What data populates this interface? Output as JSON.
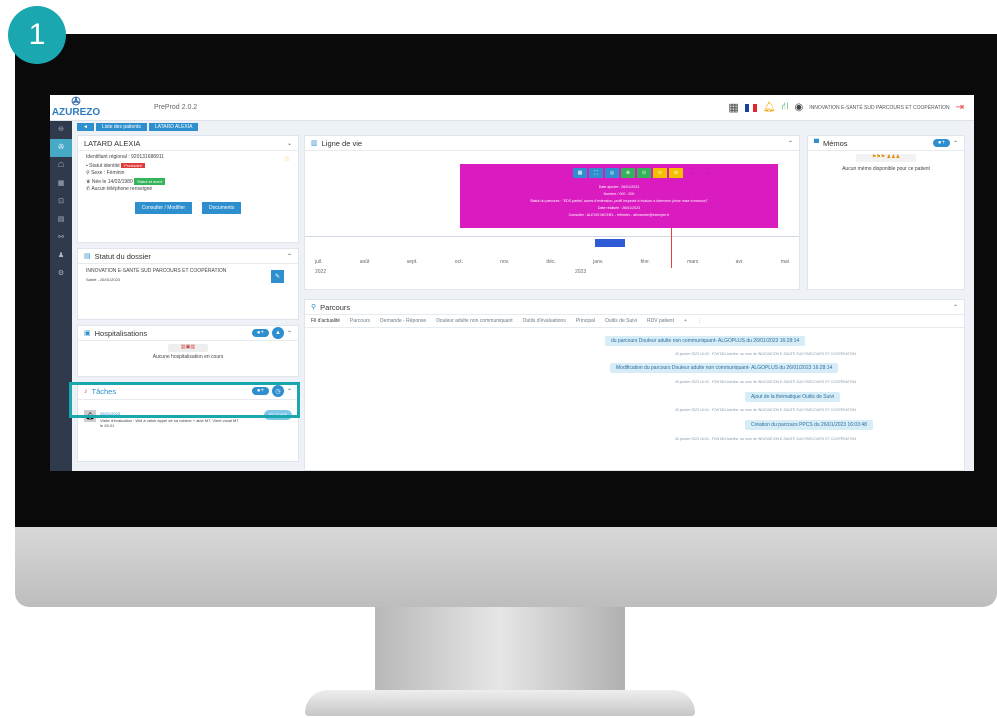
{
  "badge": {
    "number": "1"
  },
  "app": {
    "logo": "AZUREZO",
    "version": "PreProd 2.0.2",
    "org_name": "INNOVATION E-SANTÉ SUD PARCOURS ET COOPÉRATION"
  },
  "breadcrumb": [
    "Liste des patients",
    "LATARD ALEXIA"
  ],
  "patient": {
    "name": "LATARD ALEXIA",
    "id_line": "Identifiant régional : 920131688911",
    "statut_label": "Statut identité",
    "statut_value": "Provisoire",
    "sexe": "Sexe : Féminin",
    "birth": "Née le 14/02/1980",
    "birth_tag": "Statut et avert",
    "phone": "Aucun téléphone renseigné",
    "btn_consult": "Consulter / Modifier",
    "btn_docs": "Documents"
  },
  "dossier": {
    "title": "Statut du dossier",
    "org": "INNOVATION E-SANTÉ SUD PARCOURS ET COOPÉRATION",
    "line2": "Santé - 26/01/2023"
  },
  "hospitalisations": {
    "title": "Hospitalisations",
    "empty": "Aucune hospitalisation en cours"
  },
  "taches": {
    "title": "Tâches",
    "task_date": "26/01/2023",
    "task_text": "Visite d'évaluation : Wid à valoir appel de sa voisine + aide MT. Vient vocal MT le 26.01",
    "task_btn": "En cours"
  },
  "ligne_de_vie": {
    "title": "Ligne de vie",
    "months": [
      "juil.",
      "août",
      "sept.",
      "oct.",
      "nov.",
      "déc.",
      "janv.",
      "févr.",
      "mars",
      "avr.",
      "mai"
    ],
    "years": [
      "2022",
      "2023"
    ],
    "popup_lines": [
      "Date ajouter : 26/01/2023",
      "Nombre / 000 : 000",
      "Statut du parcours : \"EDS partiel, accès d'extension, profil inspecté à évaluer à intervenir (mise mise à mesure)\"",
      "Date réalisée : 26/01/2023",
      "Consulter : ALEXIS MICHEL - Infirmier - alexandre@exemple.fr"
    ]
  },
  "memos": {
    "title": "Mémos",
    "empty": "Aucun mémo disponible pour ce patient"
  },
  "parcours": {
    "title": "Parcours",
    "tabs": [
      "Fil d'actualité",
      "Parcours",
      "Demande - Réponse",
      "Douleur adulte non communiquant",
      "Outils d'évaluations",
      "Principal",
      "Outils de Suivi",
      "RDV patient"
    ],
    "events": [
      {
        "text": "du parcours Douleur adulte non communiquant- ALGOPLUS du 26/01/2023 16:28:14",
        "meta": "26 janvier 2023 16:30 - FONTAN Adeline, au nom de INNOVATION E-SANTÉ SUD PARCOURS ET COOPÉRATION"
      },
      {
        "text": "Modification du parcours Douleur adulte non communiquant- ALGOPLUS du 26/01/2023 16:28:14",
        "meta": "26 janvier 2023 16:30 - FONTAN Adeline, au nom de INNOVATION E-SANTÉ SUD PARCOURS ET COOPÉRATION"
      },
      {
        "text": "Ajout de la thématique Outils de Suivi",
        "meta": "26 janvier 2023 16:04 - FONTAN Adeline, au nom de INNOVATION E-SANTÉ SUD PARCOURS ET COOPÉRATION"
      },
      {
        "text": "Création du parcours PPCS du 26/01/2023 16:03:48",
        "meta": "26 janvier 2023 16:03 - FONTAN Adeline, au nom de INNOVATION E-SANTÉ SUD PARCOURS ET COOPÉRATION"
      }
    ]
  }
}
